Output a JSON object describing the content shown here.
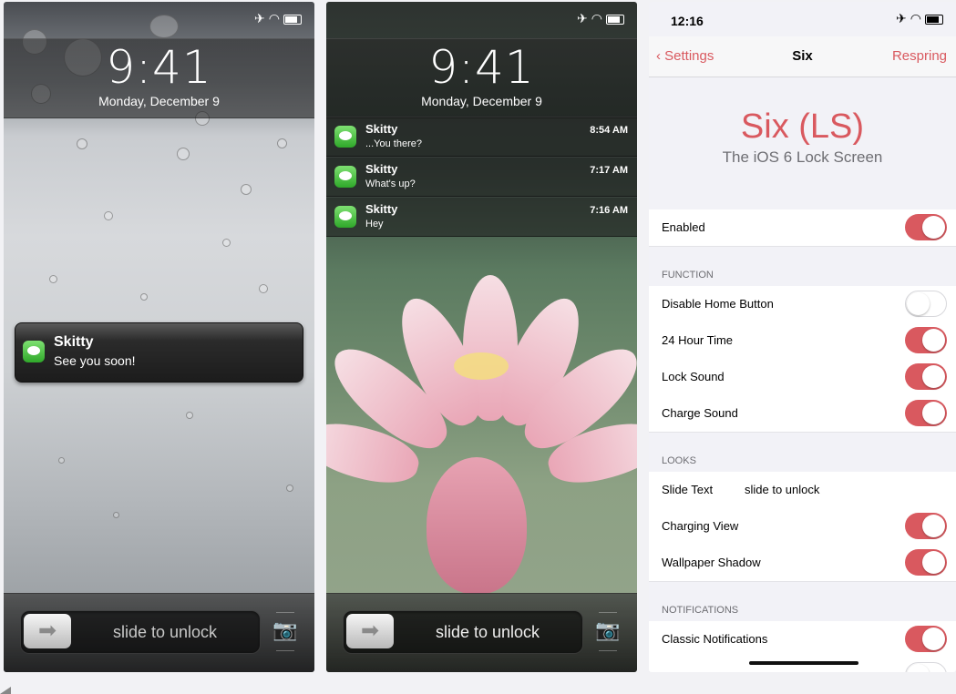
{
  "screen1": {
    "time": "9:41",
    "date": "Monday, December 9",
    "notification": {
      "title": "Skitty",
      "body": "See you soon!"
    },
    "slide_text": "slide to unlock"
  },
  "screen2": {
    "time": "9:41",
    "date": "Monday, December 9",
    "notifications": [
      {
        "title": "Skitty",
        "body": "...You there?",
        "time": "8:54 AM"
      },
      {
        "title": "Skitty",
        "body": "What's up?",
        "time": "7:17 AM"
      },
      {
        "title": "Skitty",
        "body": "Hey",
        "time": "7:16 AM"
      }
    ],
    "slide_text": "slide to unlock"
  },
  "settings": {
    "status_time": "12:16",
    "back_label": "Settings",
    "title": "Six",
    "right_action": "Respring",
    "hero_title": "Six (LS)",
    "hero_subtitle": "The iOS 6 Lock Screen",
    "enabled_label": "Enabled",
    "enabled": true,
    "sections": {
      "function": "FUNCTION",
      "looks": "LOOKS",
      "notifications": "NOTIFICATIONS"
    },
    "rows": {
      "disable_home": {
        "label": "Disable Home Button",
        "on": false
      },
      "hour24": {
        "label": "24 Hour Time",
        "on": true
      },
      "lock_sound": {
        "label": "Lock Sound",
        "on": true
      },
      "charge_sound": {
        "label": "Charge Sound",
        "on": true
      },
      "slide_text": {
        "label": "Slide Text",
        "value": "slide to unlock"
      },
      "charging_view": {
        "label": "Charging View",
        "on": true
      },
      "wallpaper_shadow": {
        "label": "Wallpaper Shadow",
        "on": true
      },
      "classic_notifications": {
        "label": "Classic Notifications",
        "on": true
      }
    },
    "accent_color": "#d9595f"
  }
}
